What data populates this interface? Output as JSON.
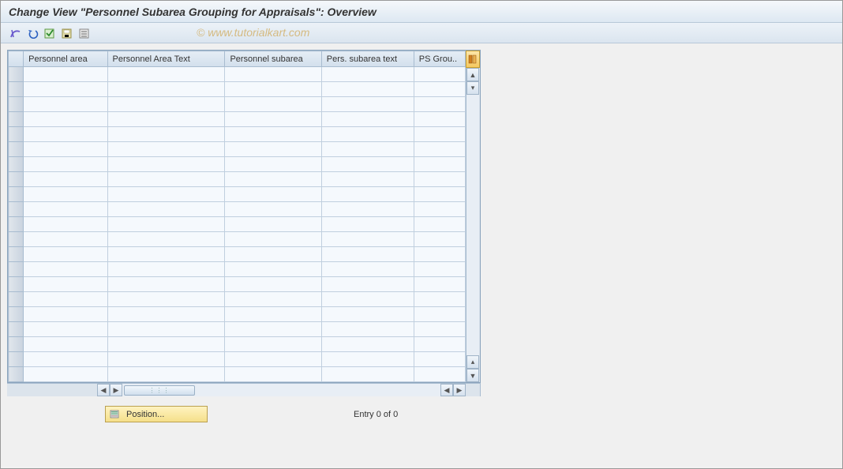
{
  "title": "Change View \"Personnel Subarea Grouping for Appraisals\": Overview",
  "watermark": "© www.tutorialkart.com",
  "table": {
    "columns": [
      "Personnel area",
      "Personnel Area Text",
      "Personnel subarea",
      "Pers. subarea text",
      "PS Grou.."
    ],
    "rows": 21
  },
  "footer": {
    "position_label": "Position...",
    "entry_text": "Entry 0 of 0"
  }
}
